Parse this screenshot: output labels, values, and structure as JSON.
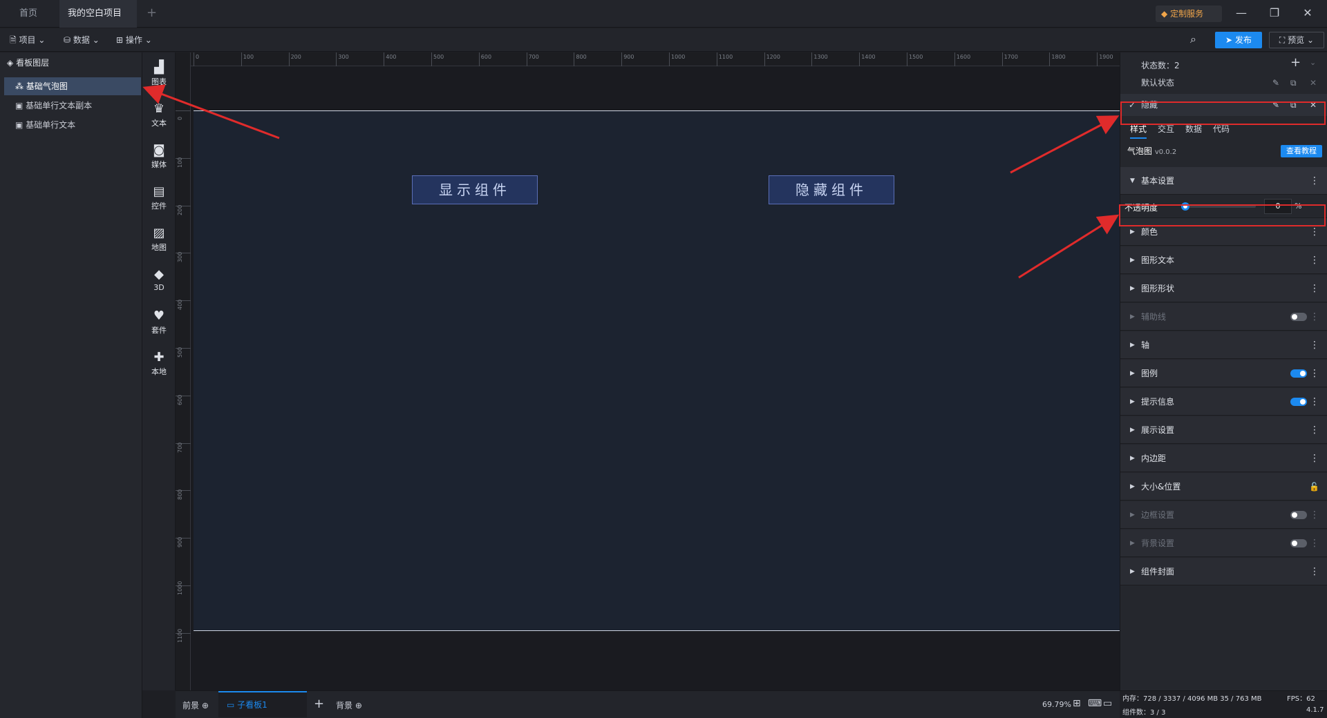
{
  "tabs": [
    {
      "label": "首页",
      "active": false
    },
    {
      "label": "我的空白项目",
      "active": true,
      "modified": true
    }
  ],
  "titlebar": {
    "custom_service": "定制服务"
  },
  "menubar": {
    "project": "项目",
    "data": "数据",
    "operation": "操作",
    "publish": "发布",
    "preview": "预览"
  },
  "layers": {
    "title": "看板图层",
    "items": [
      {
        "label": "基础气泡图",
        "selected": true
      },
      {
        "label": "基础单行文本副本",
        "selected": false
      },
      {
        "label": "基础单行文本",
        "selected": false
      }
    ]
  },
  "nav": [
    {
      "label": "图表",
      "icon": "chart-icon"
    },
    {
      "label": "文本",
      "icon": "text-icon"
    },
    {
      "label": "媒体",
      "icon": "media-icon"
    },
    {
      "label": "控件",
      "icon": "control-icon"
    },
    {
      "label": "地图",
      "icon": "map-icon"
    },
    {
      "label": "3D",
      "icon": "cube-icon"
    },
    {
      "label": "套件",
      "icon": "kit-icon"
    },
    {
      "label": "本地",
      "icon": "puzzle-icon"
    }
  ],
  "ruler": {
    "h": [
      "0",
      "100",
      "200",
      "300",
      "400",
      "500",
      "600",
      "700",
      "800",
      "900",
      "1000",
      "1100",
      "1200",
      "1300",
      "1400",
      "1500",
      "1600",
      "1700",
      "1800",
      "1900"
    ],
    "v": [
      "0",
      "100",
      "200",
      "300",
      "400",
      "500",
      "600",
      "700",
      "800",
      "900",
      "1000",
      "1100"
    ]
  },
  "canvas": {
    "show_button": "显示组件",
    "hide_button": "隐藏组件"
  },
  "bottombar": {
    "foreground": "前景",
    "board": "子看板1",
    "background": "背景",
    "zoom": "69.79%"
  },
  "states": {
    "count_label": "状态数：2",
    "items": [
      {
        "label": "默认状态",
        "active": false
      },
      {
        "label": "隐藏",
        "active": true
      }
    ]
  },
  "prop_tabs": [
    "样式",
    "交互",
    "数据",
    "代码"
  ],
  "component": {
    "name": "气泡图",
    "version": "v0.0.2",
    "tutorial": "查看教程"
  },
  "basic_settings": {
    "title": "基本设置",
    "opacity_label": "不透明度",
    "opacity_value": "0",
    "opacity_unit": "%",
    "opacity_level": 0
  },
  "sections": [
    {
      "label": "颜色",
      "control": "menu",
      "enabled": true
    },
    {
      "label": "图形文本",
      "control": "menu",
      "enabled": true
    },
    {
      "label": "图形形状",
      "control": "menu",
      "enabled": true
    },
    {
      "label": "辅助线",
      "control": "toggle-off",
      "enabled": false
    },
    {
      "label": "轴",
      "control": "menu",
      "enabled": true
    },
    {
      "label": "图例",
      "control": "toggle-on",
      "enabled": true
    },
    {
      "label": "提示信息",
      "control": "toggle-on",
      "enabled": true
    },
    {
      "label": "展示设置",
      "control": "menu",
      "enabled": true
    },
    {
      "label": "内边距",
      "control": "menu",
      "enabled": true
    },
    {
      "label": "大小&位置",
      "control": "lock",
      "enabled": true
    },
    {
      "label": "边框设置",
      "control": "toggle-off",
      "enabled": false
    },
    {
      "label": "背景设置",
      "control": "toggle-off",
      "enabled": false
    },
    {
      "label": "组件封面",
      "control": "menu",
      "enabled": true
    }
  ],
  "status": {
    "memory": "内存：728 / 3337 / 4096 MB  35 / 763 MB",
    "fps": "FPS：62",
    "components": "组件数：3 / 3",
    "version": "4.1.7"
  },
  "colors": {
    "accent": "#1c8af0",
    "annotation": "#e02b2b",
    "modified_dot": "#f5b63a"
  }
}
